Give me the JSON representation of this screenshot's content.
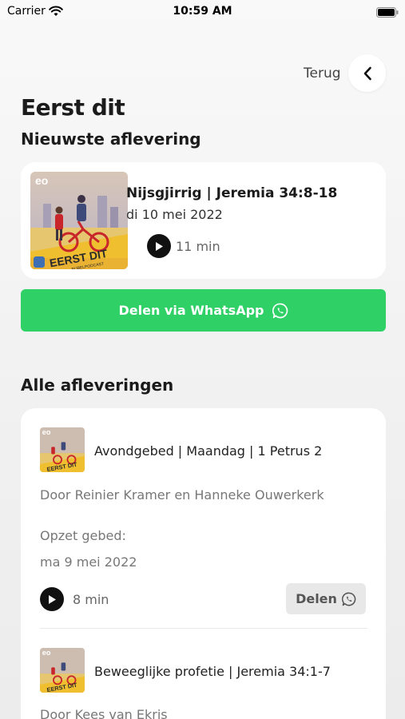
{
  "status_bar": {
    "carrier": "Carrier",
    "time": "10:59 AM"
  },
  "nav": {
    "back_label": "Terug"
  },
  "page": {
    "title": "Eerst dit"
  },
  "latest": {
    "heading": "Nieuwste aflevering",
    "episode": {
      "title": "Nijsgjirrig | Jeremia 34:8-18",
      "date": "di 10 mei 2022",
      "duration": "11 min"
    },
    "share_label": "Delen via WhatsApp"
  },
  "cover_art": {
    "brand": "eo",
    "line1": "EERST DIT",
    "line2": "BIJBELPODCAST"
  },
  "all": {
    "heading": "Alle afleveringen",
    "episodes": [
      {
        "title": "Avondgebed | Maandag | 1 Petrus 2",
        "authors": "Door Reinier Kramer en Hanneke Ouwerkerk",
        "prefix": "Opzet gebed:",
        "date": "ma 9 mei 2022",
        "duration": "8 min",
        "share_label": "Delen"
      },
      {
        "title": "Beweeglijke profetie | Jeremia 34:1-7",
        "authors": "Door Kees van Ekris"
      }
    ]
  },
  "colors": {
    "whatsapp_green": "#2fd167",
    "background": "#f3f3f3",
    "card": "#ffffff"
  }
}
